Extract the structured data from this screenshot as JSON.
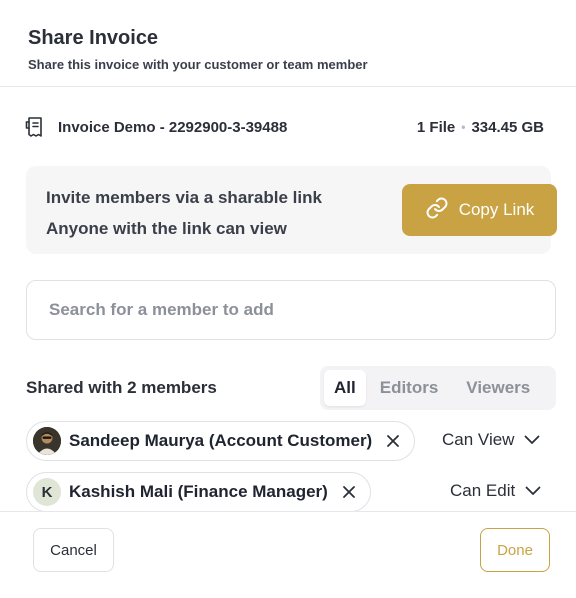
{
  "dialog": {
    "title": "Share Invoice",
    "subtitle": "Share this invoice with your customer or team member"
  },
  "file": {
    "icon": "receipt-icon",
    "name": "Invoice Demo - 2292900-3-39488",
    "count": "1 File",
    "separator": "•",
    "size": "334.45 GB"
  },
  "invite": {
    "line1": "Invite members via a sharable link",
    "line2": "Anyone with the link can view",
    "copy_button": "Copy Link",
    "copy_icon": "link-icon"
  },
  "search": {
    "placeholder": "Search for a member to add",
    "value": ""
  },
  "shared": {
    "label": "Shared with 2 members",
    "tabs": [
      {
        "label": "All",
        "active": true
      },
      {
        "label": "Editors",
        "active": false
      },
      {
        "label": "Viewers",
        "active": false
      }
    ],
    "members": [
      {
        "name": "Sandeep Maurya (Account Customer)",
        "avatar": "photo",
        "permission": "Can View"
      },
      {
        "name": "Kashish Mali (Finance Manager)",
        "avatar_initial": "K",
        "permission": "Can Edit"
      }
    ]
  },
  "footer": {
    "cancel": "Cancel",
    "done": "Done"
  },
  "colors": {
    "accent": "#c9a244",
    "border": "#dfe1e5",
    "muted_text": "#8c9099"
  }
}
